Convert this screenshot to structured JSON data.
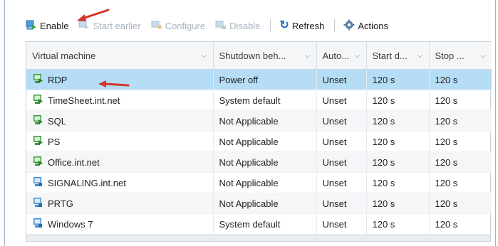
{
  "toolbar": {
    "enable_label": "Enable",
    "start_earlier_label": "Start earlier",
    "configure_label": "Configure",
    "disable_label": "Disable",
    "refresh_label": "Refresh",
    "actions_label": "Actions"
  },
  "grid": {
    "columns": [
      "Virtual machine",
      "Shutdown beh...",
      "Auto...",
      "Start d...",
      "Stop ..."
    ],
    "rows": [
      {
        "name": "RDP",
        "shutdown": "Power off",
        "auto": "Unset",
        "start": "120 s",
        "stop": "120 s",
        "icon": "vm-on-icon"
      },
      {
        "name": "TimeSheet.int.net",
        "shutdown": "System default",
        "auto": "Unset",
        "start": "120 s",
        "stop": "120 s",
        "icon": "vm-on-icon"
      },
      {
        "name": "SQL",
        "shutdown": "Not Applicable",
        "auto": "Unset",
        "start": "120 s",
        "stop": "120 s",
        "icon": "vm-on-icon"
      },
      {
        "name": "PS",
        "shutdown": "Not Applicable",
        "auto": "Unset",
        "start": "120 s",
        "stop": "120 s",
        "icon": "vm-on-icon"
      },
      {
        "name": "Office.int.net",
        "shutdown": "Not Applicable",
        "auto": "Unset",
        "start": "120 s",
        "stop": "120 s",
        "icon": "vm-on-icon"
      },
      {
        "name": "SIGNALING.int.net",
        "shutdown": "Not Applicable",
        "auto": "Unset",
        "start": "120 s",
        "stop": "120 s",
        "icon": "vm-off-icon"
      },
      {
        "name": "PRTG",
        "shutdown": "Not Applicable",
        "auto": "Unset",
        "start": "120 s",
        "stop": "120 s",
        "icon": "vm-off-icon"
      },
      {
        "name": "Windows 7",
        "shutdown": "System default",
        "auto": "Unset",
        "start": "120 s",
        "stop": "120 s",
        "icon": "vm-off-icon"
      }
    ],
    "selected_row": 0
  },
  "colors": {
    "selected_row": "#b5ddf6",
    "vm_on": "#3c9b3a",
    "vm_off": "#3d8fd6",
    "annotation_arrow": "#d9342b"
  }
}
